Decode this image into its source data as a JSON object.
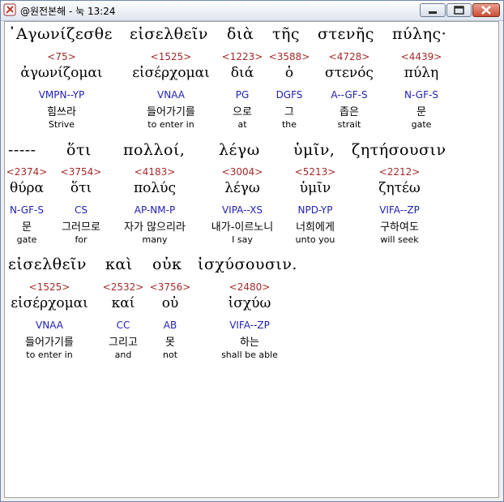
{
  "window": {
    "title": "@원전본해 - 눅 13:24"
  },
  "lines": [
    {
      "greek": [
        "᾿Αγωνίζεσθε",
        "εἰσελθεῖν",
        "διὰ",
        "τῆς",
        "στενῆς",
        "πύλης·"
      ],
      "entries": [
        {
          "strong": "<75>",
          "lemma": "ἀγωνίζομαι",
          "morph": "VMPN--YP",
          "korean": "힘쓰라",
          "english": "Strive"
        },
        {
          "strong": "<1525>",
          "lemma": "εἰσέρχομαι",
          "morph": "VNAA",
          "korean": "들어가기를",
          "english": "to enter in"
        },
        {
          "strong": "<1223>",
          "lemma": "διά",
          "morph": "PG",
          "korean": "으로",
          "english": "at"
        },
        {
          "strong": "<3588>",
          "lemma": "ὁ",
          "morph": "DGFS",
          "korean": "그",
          "english": "the"
        },
        {
          "strong": "<4728>",
          "lemma": "στενός",
          "morph": "A--GF-S",
          "korean": "좁은",
          "english": "strait"
        },
        {
          "strong": "<4439>",
          "lemma": "πύλη",
          "morph": "N-GF-S",
          "korean": "문",
          "english": "gate"
        }
      ]
    },
    {
      "greek": [
        "-----",
        "ὅτι",
        "πολλοί,",
        "λέγω",
        "ὑμῖν,",
        "ζητήσουσιν"
      ],
      "entries": [
        {
          "strong": "<2374>",
          "lemma": "θύρα",
          "morph": "N-GF-S",
          "korean": "문",
          "english": "gate"
        },
        {
          "strong": "<3754>",
          "lemma": "ὅτι",
          "morph": "CS",
          "korean": "그러므로",
          "english": "for"
        },
        {
          "strong": "<4183>",
          "lemma": "πολύς",
          "morph": "AP-NM-P",
          "korean": "자가 많으리라",
          "english": "many"
        },
        {
          "strong": "<3004>",
          "lemma": "λέγω",
          "morph": "VIPA--XS",
          "korean": "내가-이르노니",
          "english": "I say"
        },
        {
          "strong": "<5213>",
          "lemma": "ὑμῖν",
          "morph": "NPD-YP",
          "korean": "너희에게",
          "english": "unto you"
        },
        {
          "strong": "<2212>",
          "lemma": "ζητέω",
          "morph": "VIFA--ZP",
          "korean": "구하여도",
          "english": "will seek"
        }
      ]
    },
    {
      "greek": [
        "εἰσελθεῖν",
        "καὶ",
        "οὐκ",
        "ἰσχύσουσιν."
      ],
      "entries": [
        {
          "strong": "<1525>",
          "lemma": "εἰσέρχομαι",
          "morph": "VNAA",
          "korean": "들어가기를",
          "english": "to enter in"
        },
        {
          "strong": "<2532>",
          "lemma": "καί",
          "morph": "CC",
          "korean": "그리고",
          "english": "and"
        },
        {
          "strong": "<3756>",
          "lemma": "οὐ",
          "morph": "AB",
          "korean": "못",
          "english": "not"
        },
        {
          "strong": "<2480>",
          "lemma": "ἰσχύω",
          "morph": "VIFA--ZP",
          "korean": "하는",
          "english": "shall be able"
        }
      ]
    }
  ],
  "colors": {
    "strong": "#a52a2a",
    "morph": "#1f1fb4",
    "text": "#000000"
  }
}
